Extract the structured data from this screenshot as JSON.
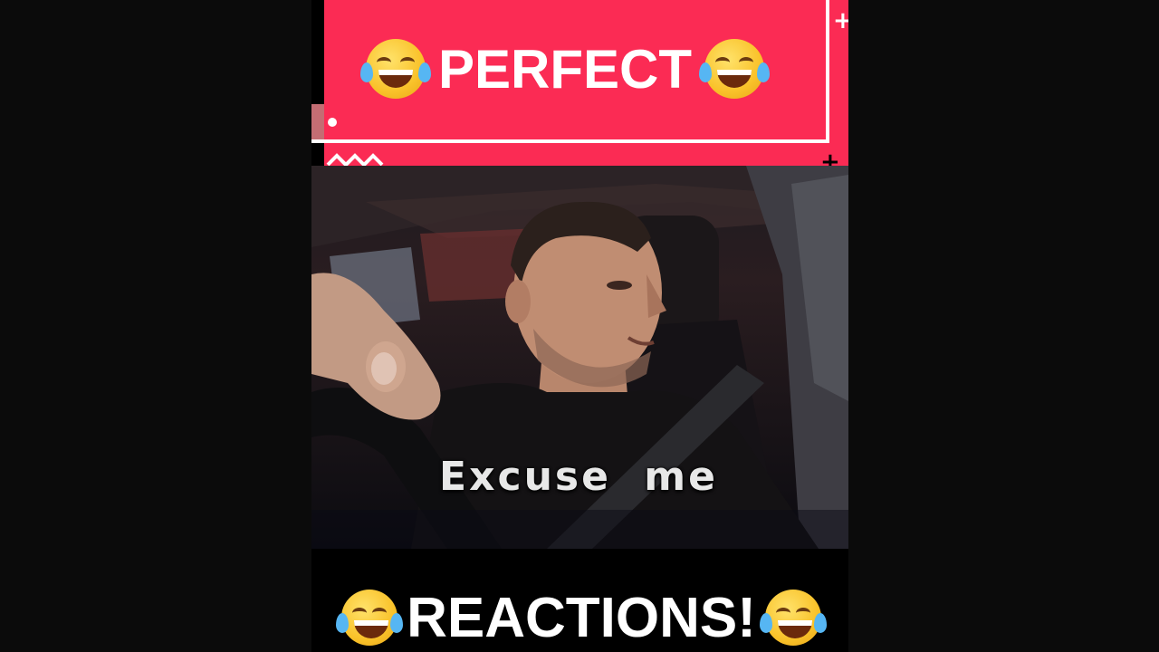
{
  "banner": {
    "title": "PERFECT",
    "left_emoji": "face-with-tears-of-joy-icon",
    "right_emoji": "face-with-tears-of-joy-icon",
    "color": "#fb2b54"
  },
  "video": {
    "caption": "Excuse me"
  },
  "footer": {
    "title": "REACTIONS!",
    "left_emoji": "face-with-tears-of-joy-icon",
    "right_emoji": "face-with-tears-of-joy-icon"
  }
}
